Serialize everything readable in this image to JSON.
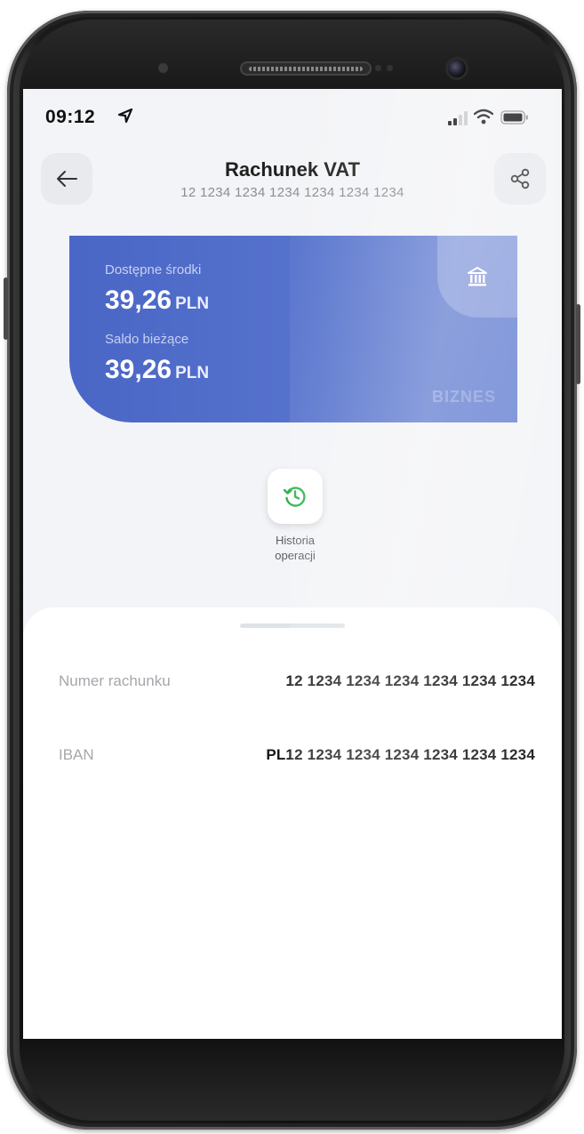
{
  "status_bar": {
    "time": "09:12"
  },
  "header": {
    "title": "Rachunek VAT",
    "subtitle": "12 1234 1234 1234 1234 1234 1234"
  },
  "card": {
    "available_label": "Dostępne środki",
    "available_amount": "39,26",
    "available_currency": "PLN",
    "balance_label": "Saldo bieżące",
    "balance_amount": "39,26",
    "balance_currency": "PLN",
    "tag": "BIZNES",
    "color": "#4a66c6"
  },
  "action": {
    "label_line1": "Historia",
    "label_line2": "operacji",
    "accent": "#2fb24c"
  },
  "details": [
    {
      "label": "Numer rachunku",
      "value": "12 1234 1234 1234 1234 1234 1234"
    },
    {
      "label": "IBAN",
      "value": "PL12 1234 1234 1234 1234 1234 1234"
    }
  ],
  "icons": {
    "back": "arrow-left-icon",
    "share": "share-icon",
    "bank": "bank-icon",
    "history": "history-icon",
    "location": "location-arrow-icon",
    "signal": "signal-icon",
    "wifi": "wifi-icon",
    "battery": "battery-icon"
  }
}
